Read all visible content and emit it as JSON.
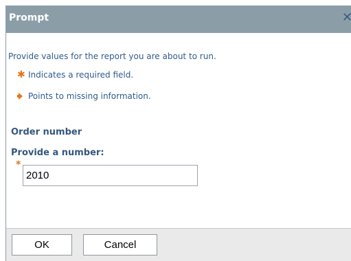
{
  "dialog": {
    "title": "Prompt",
    "close_glyph": "✕"
  },
  "content": {
    "intro": "Provide values for the report you are about to run.",
    "legend": [
      {
        "icon": "asterisk-icon",
        "text": "Indicates a required field."
      },
      {
        "icon": "arrow-right-icon",
        "text": "Points to missing information."
      }
    ],
    "section_label": "Order number",
    "field_label": "Provide a number:",
    "required_marker": "*",
    "input_value": "2010"
  },
  "footer": {
    "ok_label": "OK",
    "cancel_label": "Cancel"
  },
  "colors": {
    "titlebar": "#8b9ea8",
    "text_blue": "#2f5c8c",
    "accent_orange": "#e8731a"
  }
}
